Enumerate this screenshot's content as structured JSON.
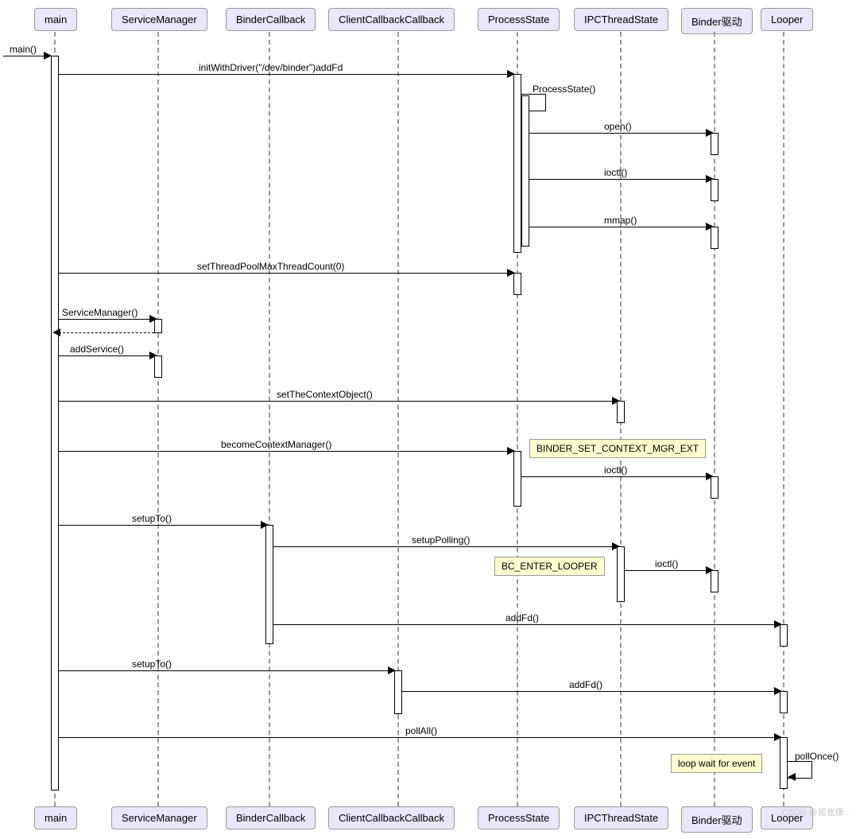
{
  "participants": {
    "main": "main",
    "serviceManager": "ServiceManager",
    "binderCallback": "BinderCallback",
    "clientCallback": "ClientCallbackCallback",
    "processState": "ProcessState",
    "ipcThreadState": "IPCThreadState",
    "binderDriver": "Binder驱动",
    "looper": "Looper"
  },
  "messages": {
    "m1": "main()",
    "m2": "initWithDriver(\"/dev/binder\")addFd",
    "m3": "ProcessState()",
    "m4": "open()",
    "m5": "ioctl()",
    "m6": "mmap()",
    "m7": "setThreadPoolMaxThreadCount(0)",
    "m8": "ServiceManager()",
    "m9": "addService()",
    "m10": "setTheContextObject()",
    "m11": "becomeContextManager()",
    "m12": "ioctl()",
    "m13": "setupTo()",
    "m14": "setupPolling()",
    "m15": "ioctl()",
    "m16": "addFd()",
    "m17": "setupTo()",
    "m18": "addFd()",
    "m19": "pollAll()",
    "m20": "pollOnce()"
  },
  "notes": {
    "n1": "BINDER_SET_CONTEXT_MGR_EXT",
    "n2": "BC_ENTER_LOOPER",
    "n3": "loop wait for event"
  },
  "watermark": "CSDN @姬崔康..."
}
